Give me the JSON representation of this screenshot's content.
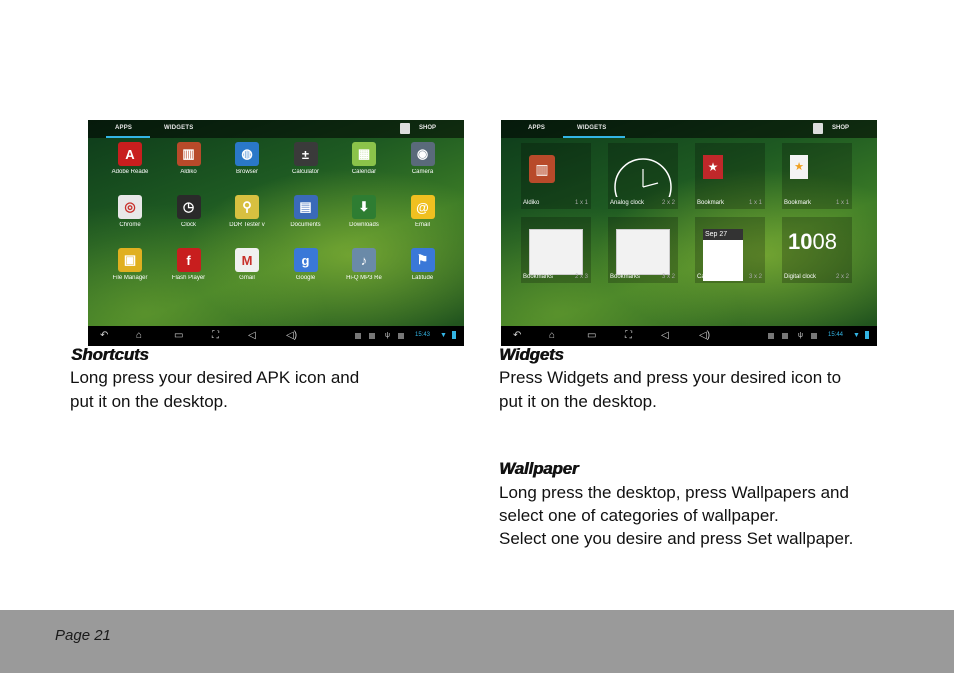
{
  "left_screen": {
    "tabs": [
      "APPS",
      "WIDGETS"
    ],
    "shop": "SHOP",
    "time": "15:43",
    "apps": [
      {
        "label": "Adobe Reade",
        "icon": "adobe-reader-icon",
        "color": "#c81e1e",
        "glyph": "A"
      },
      {
        "label": "Aldiko",
        "icon": "aldiko-icon",
        "color": "#b84a2a",
        "glyph": "▥"
      },
      {
        "label": "Browser",
        "icon": "browser-globe-icon",
        "color": "#2a78c8",
        "glyph": "◍"
      },
      {
        "label": "Calculator",
        "icon": "calculator-icon",
        "color": "#3a3a3a",
        "glyph": "±"
      },
      {
        "label": "Calendar",
        "icon": "calendar-icon",
        "color": "#8bc34a",
        "glyph": "▦"
      },
      {
        "label": "Camera",
        "icon": "camera-icon",
        "color": "#5a6a7a",
        "glyph": "◉"
      },
      {
        "label": "Chrome",
        "icon": "chrome-icon",
        "color": "#e8e8e8",
        "glyph": "◎"
      },
      {
        "label": "Clock",
        "icon": "clock-icon",
        "color": "#2a2a2a",
        "glyph": "◷"
      },
      {
        "label": "DDR Tester v",
        "icon": "ddr-tester-icon",
        "color": "#d8c040",
        "glyph": "⚲"
      },
      {
        "label": "Documents",
        "icon": "documents-icon",
        "color": "#3a6ab8",
        "glyph": "▤"
      },
      {
        "label": "Downloads",
        "icon": "downloads-icon",
        "color": "#2e7d32",
        "glyph": "⬇"
      },
      {
        "label": "Email",
        "icon": "email-icon",
        "color": "#f0c020",
        "glyph": "@"
      },
      {
        "label": "File Manager",
        "icon": "file-manager-icon",
        "color": "#e0b020",
        "glyph": "▣"
      },
      {
        "label": "Flash Player",
        "icon": "flash-player-icon",
        "color": "#c81e1e",
        "glyph": "f"
      },
      {
        "label": "Gmail",
        "icon": "gmail-icon",
        "color": "#f0f0f0",
        "glyph": "M"
      },
      {
        "label": "Google",
        "icon": "google-icon",
        "color": "#3a78d8",
        "glyph": "g"
      },
      {
        "label": "Hi-Q MP3 Re",
        "icon": "microphone-icon",
        "color": "#6a8aa8",
        "glyph": "♪"
      },
      {
        "label": "Latitude",
        "icon": "latitude-icon",
        "color": "#3a78d8",
        "glyph": "⚑"
      }
    ]
  },
  "right_screen": {
    "tabs": [
      "APPS",
      "WIDGETS"
    ],
    "shop": "SHOP",
    "time": "15:44",
    "widgets": [
      {
        "label": "Aldiko",
        "size": "1 x 1",
        "icon": "aldiko-widget-icon"
      },
      {
        "label": "Analog clock",
        "size": "2 x 2",
        "icon": "analog-clock-icon"
      },
      {
        "label": "Bookmark",
        "size": "1 x 1",
        "icon": "bookmark-icon"
      },
      {
        "label": "Bookmark",
        "size": "1 x 1",
        "icon": "bookmark-star-icon"
      },
      {
        "label": "Bookmarks",
        "size": "2 x 3",
        "icon": "bookmarks-grid-icon"
      },
      {
        "label": "Bookmarks",
        "size": "3 x 2",
        "icon": "bookmarks-list-icon"
      },
      {
        "label": "Calendar",
        "size": "3 x 2",
        "icon": "calendar-widget-icon",
        "date": "Sep 27"
      },
      {
        "label": "Digital clock",
        "size": "2 x 2",
        "icon": "digital-clock-icon",
        "time_big": "10",
        "time_small": "08"
      }
    ]
  },
  "sections": {
    "shortcuts": {
      "title": "Shortcuts",
      "lines": [
        "Long press your desired APK icon and",
        "put it on the desktop."
      ]
    },
    "widgets": {
      "title": "Widgets",
      "lines": [
        "Press Widgets and press your desired icon to",
        "put it on the desktop."
      ]
    },
    "wallpaper": {
      "title": "Wallpaper",
      "lines": [
        "Long press the desktop, press Wallpapers and",
        "select one of categories of wallpaper.",
        "Select one you desire and press Set wallpaper."
      ]
    }
  },
  "footer": {
    "page": "Page 21"
  }
}
